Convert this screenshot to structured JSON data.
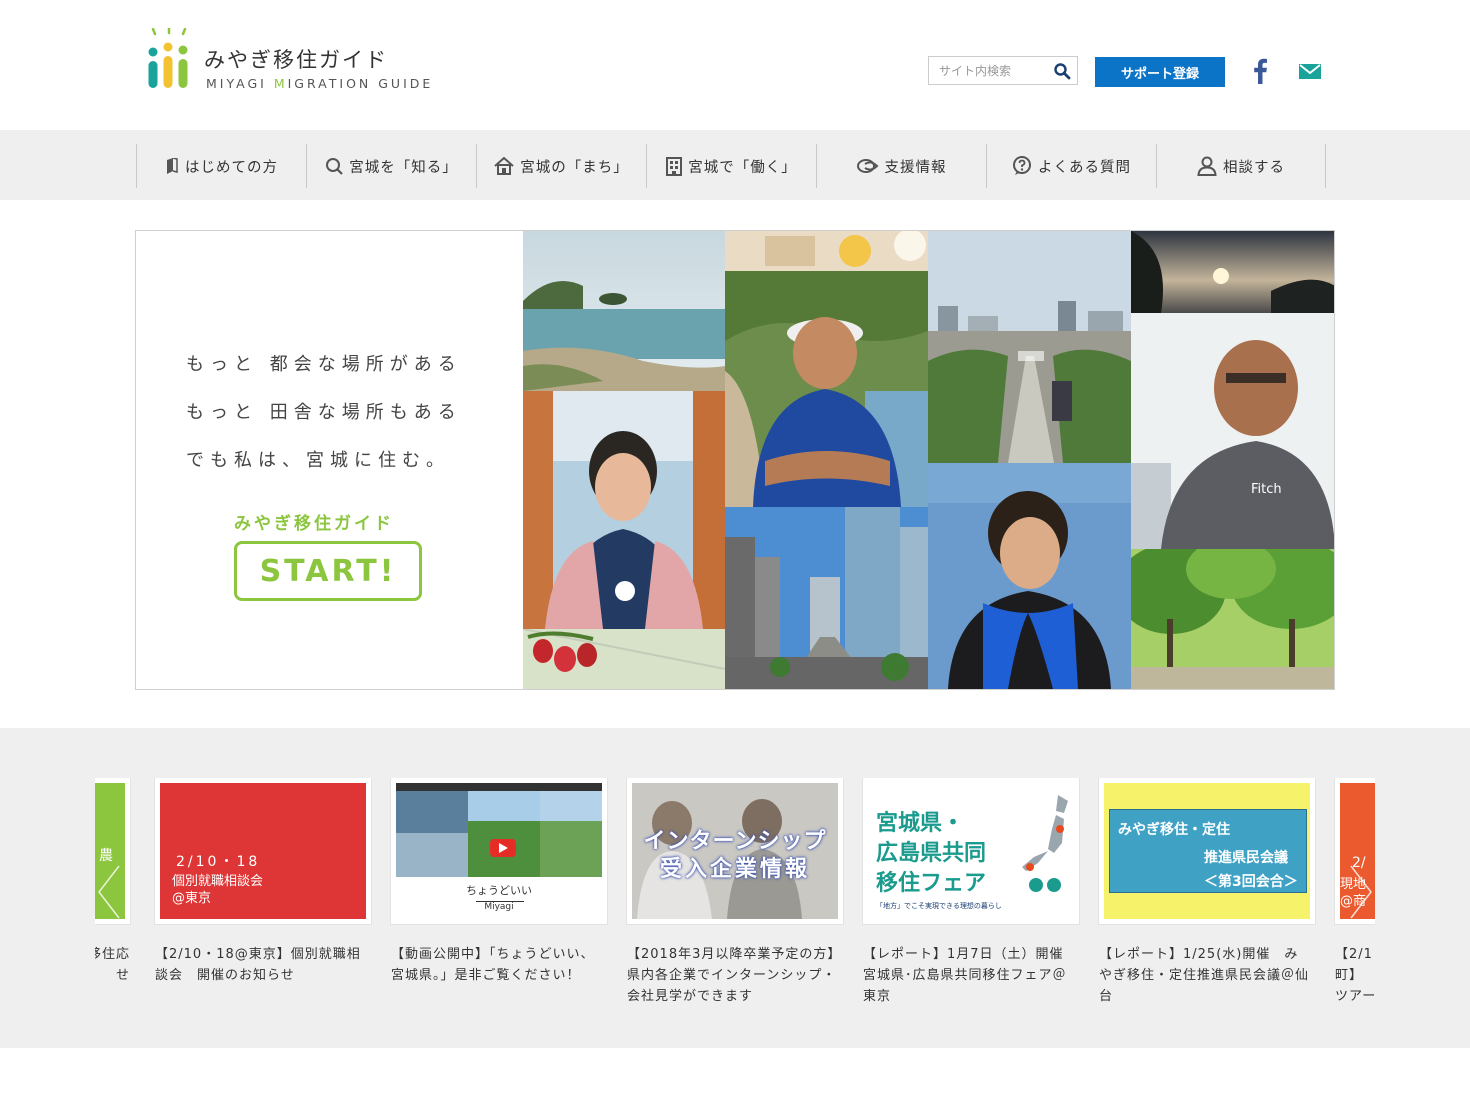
{
  "header": {
    "logo_title": "みやぎ移住ガイド",
    "logo_sub_a": "MIYAGI ",
    "logo_sub_b": "M",
    "logo_sub_c": "IGRATION GUIDE",
    "search_placeholder": "サイト内検索",
    "support_label": "サポート登録"
  },
  "nav": {
    "items": [
      {
        "label": "はじめての方",
        "icon": "book-icon"
      },
      {
        "label": "宮城を「知る」",
        "icon": "search-icon"
      },
      {
        "label": "宮城の「まち」",
        "icon": "house-icon"
      },
      {
        "label": "宮城で「働く」",
        "icon": "building-icon"
      },
      {
        "label": "支援情報",
        "icon": "support-icon"
      },
      {
        "label": "よくある質問",
        "icon": "question-icon"
      },
      {
        "label": "相談する",
        "icon": "person-icon"
      }
    ]
  },
  "hero": {
    "line1": "もっと 都会な場所がある",
    "line2": "もっと 田舎な場所もある",
    "line3": "でも私は、宮城に住む。",
    "brand": "みやぎ移住ガイド",
    "start_label": "START!"
  },
  "news": {
    "cards": [
      {
        "thumb_text": "農",
        "caption": "移住応\nせ"
      },
      {
        "thumb_date": "2/10・18",
        "thumb_title": "個別就職相談会",
        "thumb_place": "@東京",
        "caption": "【2/10・18@東京】個別就職相談会　開催のお知らせ"
      },
      {
        "thumb_text": "ちょうどいい",
        "thumb_sub": "Miyagi",
        "caption": "【動画公開中】「ちょうどいい、宮城県。」是非ご覧ください！"
      },
      {
        "thumb_text": "インターンシップ",
        "thumb_sub": "受入企業情報",
        "caption": "【2018年3月以降卒業予定の方】県内各企業でインターンシップ・会社見学ができます"
      },
      {
        "thumb_text": "宮城県・",
        "thumb_sub": "広島県共同",
        "thumb_sub2": "移住フェア",
        "thumb_note": "「地方」でこそ実現できる理想の暮らし",
        "caption": "【レポート】1月7日（土）開催　宮城県･広島県共同移住フェア＠東京"
      },
      {
        "thumb_text": "みやぎ移住・定住",
        "thumb_sub": "推進県民会議",
        "thumb_sub2": "＜第3回会合＞",
        "caption": "【レポート】1/25(水)開催　みやぎ移住・定住推進県民会議＠仙台"
      },
      {
        "thumb_text": "2/",
        "thumb_sub": "現地",
        "thumb_sub2": "@商",
        "caption": "【2/1\n町】\nツアー"
      }
    ]
  },
  "colors": {
    "brand_green": "#8cc63f",
    "support_blue": "#0b74c7",
    "facebook_blue": "#3b5998",
    "mail_teal": "#1aa39a"
  }
}
